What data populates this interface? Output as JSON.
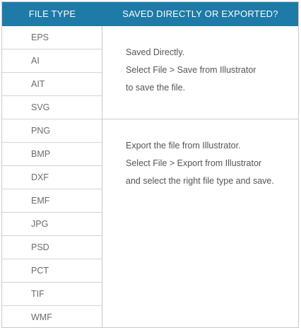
{
  "header": {
    "col1": "FILE TYPE",
    "col2": "SAVED DIRECTLY OR EXPORTED?"
  },
  "groups": [
    {
      "types": [
        "EPS",
        "AI",
        "AIT",
        "SVG"
      ],
      "description": [
        "Saved Directly.",
        "Select File > Save from Illustrator",
        "to save the file."
      ]
    },
    {
      "types": [
        "PNG",
        "BMP",
        "DXF",
        "EMF",
        "JPG",
        "PSD",
        "PCT",
        "TIF",
        "WMF"
      ],
      "description": [
        "Export the file from Illustrator.",
        "Select File > Export from Illustrator",
        "and select the right file type and save."
      ]
    }
  ],
  "colors": {
    "header_bg": "#1e7aa6",
    "header_text": "#ffffff",
    "body_text": "#6b6b6b",
    "border": "#c9c9c9"
  }
}
